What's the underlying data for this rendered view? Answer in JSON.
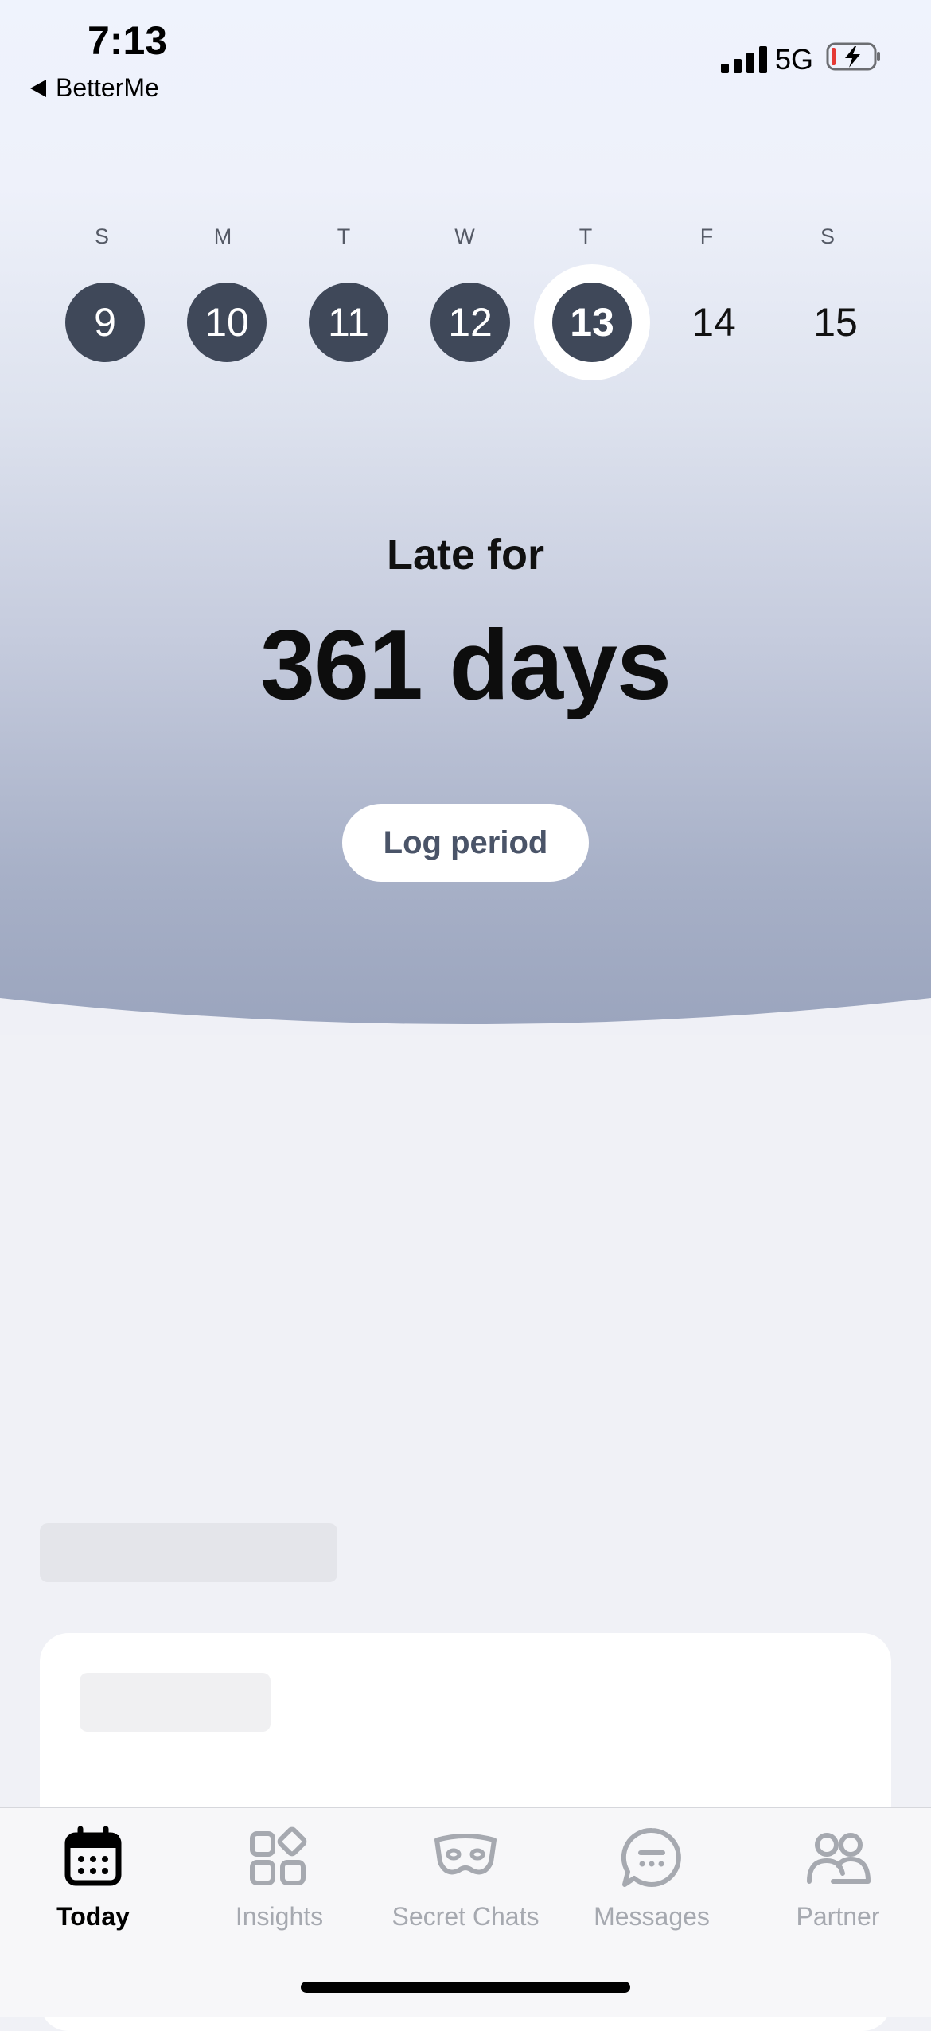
{
  "status_bar": {
    "time": "7:13",
    "back_app": "BetterMe",
    "network": "5G"
  },
  "calendar": {
    "weekdays": [
      "S",
      "M",
      "T",
      "W",
      "T",
      "F",
      "S"
    ],
    "days": [
      {
        "label": "9",
        "state": "past"
      },
      {
        "label": "10",
        "state": "past"
      },
      {
        "label": "11",
        "state": "past"
      },
      {
        "label": "12",
        "state": "past"
      },
      {
        "label": "13",
        "state": "today"
      },
      {
        "label": "14",
        "state": "future"
      },
      {
        "label": "15",
        "state": "future"
      }
    ]
  },
  "summary": {
    "caption": "Late for",
    "value": "361 days",
    "action": "Log period"
  },
  "tabs": [
    {
      "label": "Today",
      "icon": "calendar-icon",
      "active": true
    },
    {
      "label": "Insights",
      "icon": "insights-grid-icon",
      "active": false
    },
    {
      "label": "Secret Chats",
      "icon": "mask-icon",
      "active": false
    },
    {
      "label": "Messages",
      "icon": "chat-bubble-icon",
      "active": false
    },
    {
      "label": "Partner",
      "icon": "partner-icon",
      "active": false
    }
  ],
  "colors": {
    "day_fill": "#3f4859",
    "accent_text": "#4a5468",
    "tab_inactive": "#a6a9b0"
  }
}
